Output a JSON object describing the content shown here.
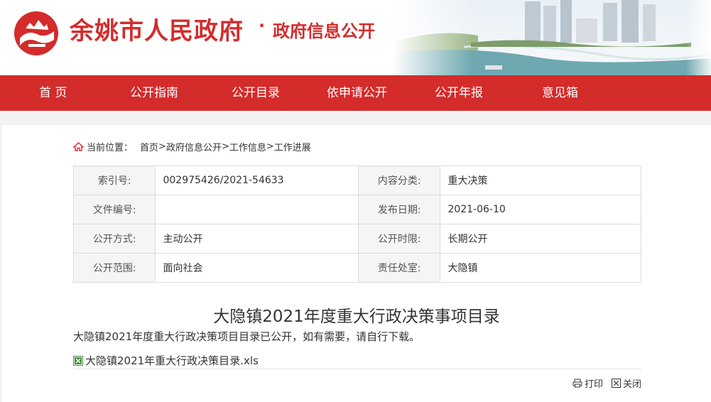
{
  "header": {
    "site_title": "余姚市人民政府",
    "separator": "·",
    "subtitle": "政府信息公开"
  },
  "nav": {
    "items": [
      {
        "label": "首 页"
      },
      {
        "label": "公开指南"
      },
      {
        "label": "公开目录"
      },
      {
        "label": "依申请公开"
      },
      {
        "label": "公开年报"
      },
      {
        "label": "意见箱"
      }
    ]
  },
  "breadcrumb": {
    "prefix": "当前位置：",
    "items": [
      "首页",
      "政府信息公开",
      "工作信息",
      "工作进展"
    ],
    "sep": ">"
  },
  "info": {
    "index_label": "索引号:",
    "index_value": "002975426/2021-54633",
    "category_label": "内容分类:",
    "category_value": "重大决策",
    "docno_label": "文件编号:",
    "docno_value": "",
    "pubdate_label": "发布日期:",
    "pubdate_value": "2021-06-10",
    "method_label": "公开方式:",
    "method_value": "主动公开",
    "term_label": "公开时限:",
    "term_value": "长期公开",
    "scope_label": "公开范围:",
    "scope_value": "面向社会",
    "dept_label": "责任处室:",
    "dept_value": "大隐镇"
  },
  "article": {
    "title": "大隐镇2021年度重大行政决策事项目录",
    "body": "大隐镇2021年度重大行政决策项目目录已公开，如有需要，请自行下载。",
    "attachment": "大隐镇2021年重大行政决策目录.xls"
  },
  "tools": {
    "print": "打印",
    "close": "关闭"
  },
  "colors": {
    "brand_red": "#d42b2b",
    "background": "#f2f2f2"
  }
}
